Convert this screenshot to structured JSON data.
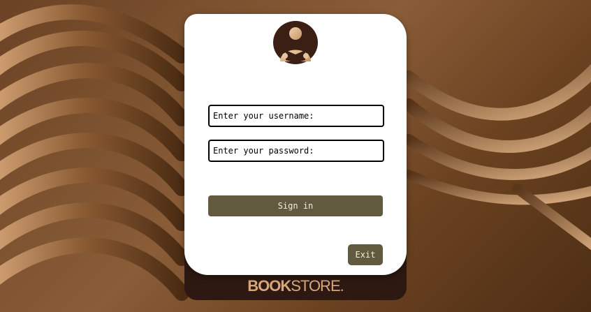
{
  "login": {
    "username_placeholder": "Enter your username:",
    "password_placeholder": "Enter your password:",
    "signin_label": "Sign in",
    "exit_label": "Exit"
  },
  "brand": {
    "logo_bold": "BOOK",
    "logo_rest": "STORE."
  },
  "colors": {
    "button": "#625a3e",
    "card_footer": "#2e1812",
    "logo": "#d9a87a",
    "background": "#7a5030"
  },
  "icons": {
    "avatar": "reader-avatar-icon"
  }
}
